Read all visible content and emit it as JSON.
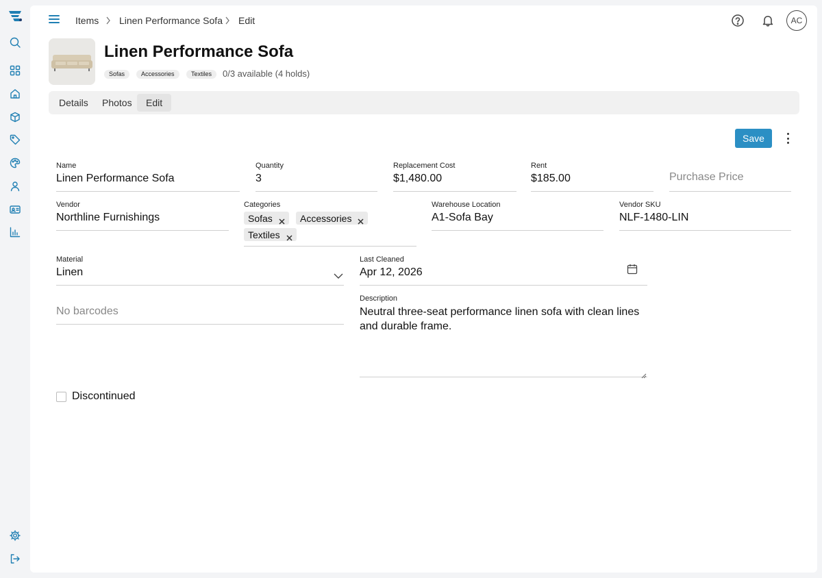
{
  "nav": {
    "icons": [
      "logo-icon",
      "search-icon",
      "dashboard-icon",
      "home-icon",
      "box-icon",
      "tag-icon",
      "palette-icon",
      "person-icon",
      "id-card-icon",
      "bar-chart-icon",
      "gear-icon",
      "logout-icon"
    ]
  },
  "topbar": {
    "breadcrumb": [
      "Items",
      "Linen Performance Sofa",
      "Edit"
    ],
    "avatar": "AC"
  },
  "item": {
    "title": "Linen Performance Sofa",
    "tags": [
      "Sofas",
      "Accessories",
      "Textiles"
    ],
    "availability": "0/3 available (4 holds)"
  },
  "tabs": [
    "Details",
    "Photos",
    "Edit"
  ],
  "active_tab": "Edit",
  "actions": {
    "save": "Save"
  },
  "form": {
    "name": {
      "label": "Name",
      "value": "Linen Performance Sofa"
    },
    "quantity": {
      "label": "Quantity",
      "value": "3"
    },
    "replacement_cost": {
      "label": "Replacement Cost",
      "value": "$1,480.00"
    },
    "rent": {
      "label": "Rent",
      "value": "$185.00"
    },
    "purchase_price": {
      "placeholder": "Purchase Price"
    },
    "vendor": {
      "label": "Vendor",
      "value": "Northline Furnishings"
    },
    "categories": {
      "label": "Categories",
      "values": [
        "Sofas",
        "Accessories",
        "Textiles"
      ]
    },
    "warehouse_location": {
      "label": "Warehouse Location",
      "value": "A1-Sofa Bay"
    },
    "vendor_sku": {
      "label": "Vendor SKU",
      "value": "NLF-1480-LIN"
    },
    "material": {
      "label": "Material",
      "value": "Linen"
    },
    "last_cleaned": {
      "label": "Last Cleaned",
      "value": "Apr 12, 2026"
    },
    "barcodes": {
      "placeholder": "No barcodes"
    },
    "description": {
      "label": "Description",
      "value": "Neutral three-seat performance linen sofa with clean lines and durable frame."
    },
    "discontinued": {
      "label": "Discontinued",
      "checked": false
    }
  },
  "colors": {
    "accent": "#2b8fc4",
    "icon": "#1f7fb3"
  }
}
